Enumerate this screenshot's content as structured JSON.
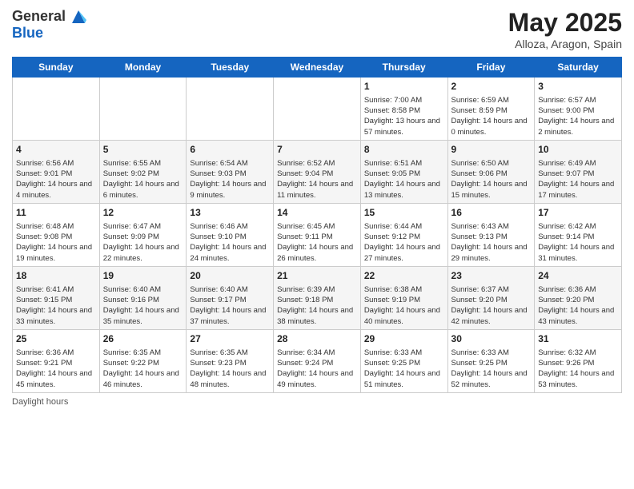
{
  "logo": {
    "line1": "General",
    "line2": "Blue"
  },
  "title": "May 2025",
  "location": "Alloza, Aragon, Spain",
  "days_of_week": [
    "Sunday",
    "Monday",
    "Tuesday",
    "Wednesday",
    "Thursday",
    "Friday",
    "Saturday"
  ],
  "footer": "Daylight hours",
  "weeks": [
    [
      {
        "day": "",
        "sunrise": "",
        "sunset": "",
        "daylight": ""
      },
      {
        "day": "",
        "sunrise": "",
        "sunset": "",
        "daylight": ""
      },
      {
        "day": "",
        "sunrise": "",
        "sunset": "",
        "daylight": ""
      },
      {
        "day": "",
        "sunrise": "",
        "sunset": "",
        "daylight": ""
      },
      {
        "day": "1",
        "sunrise": "Sunrise: 7:00 AM",
        "sunset": "Sunset: 8:58 PM",
        "daylight": "Daylight: 13 hours and 57 minutes."
      },
      {
        "day": "2",
        "sunrise": "Sunrise: 6:59 AM",
        "sunset": "Sunset: 8:59 PM",
        "daylight": "Daylight: 14 hours and 0 minutes."
      },
      {
        "day": "3",
        "sunrise": "Sunrise: 6:57 AM",
        "sunset": "Sunset: 9:00 PM",
        "daylight": "Daylight: 14 hours and 2 minutes."
      }
    ],
    [
      {
        "day": "4",
        "sunrise": "Sunrise: 6:56 AM",
        "sunset": "Sunset: 9:01 PM",
        "daylight": "Daylight: 14 hours and 4 minutes."
      },
      {
        "day": "5",
        "sunrise": "Sunrise: 6:55 AM",
        "sunset": "Sunset: 9:02 PM",
        "daylight": "Daylight: 14 hours and 6 minutes."
      },
      {
        "day": "6",
        "sunrise": "Sunrise: 6:54 AM",
        "sunset": "Sunset: 9:03 PM",
        "daylight": "Daylight: 14 hours and 9 minutes."
      },
      {
        "day": "7",
        "sunrise": "Sunrise: 6:52 AM",
        "sunset": "Sunset: 9:04 PM",
        "daylight": "Daylight: 14 hours and 11 minutes."
      },
      {
        "day": "8",
        "sunrise": "Sunrise: 6:51 AM",
        "sunset": "Sunset: 9:05 PM",
        "daylight": "Daylight: 14 hours and 13 minutes."
      },
      {
        "day": "9",
        "sunrise": "Sunrise: 6:50 AM",
        "sunset": "Sunset: 9:06 PM",
        "daylight": "Daylight: 14 hours and 15 minutes."
      },
      {
        "day": "10",
        "sunrise": "Sunrise: 6:49 AM",
        "sunset": "Sunset: 9:07 PM",
        "daylight": "Daylight: 14 hours and 17 minutes."
      }
    ],
    [
      {
        "day": "11",
        "sunrise": "Sunrise: 6:48 AM",
        "sunset": "Sunset: 9:08 PM",
        "daylight": "Daylight: 14 hours and 19 minutes."
      },
      {
        "day": "12",
        "sunrise": "Sunrise: 6:47 AM",
        "sunset": "Sunset: 9:09 PM",
        "daylight": "Daylight: 14 hours and 22 minutes."
      },
      {
        "day": "13",
        "sunrise": "Sunrise: 6:46 AM",
        "sunset": "Sunset: 9:10 PM",
        "daylight": "Daylight: 14 hours and 24 minutes."
      },
      {
        "day": "14",
        "sunrise": "Sunrise: 6:45 AM",
        "sunset": "Sunset: 9:11 PM",
        "daylight": "Daylight: 14 hours and 26 minutes."
      },
      {
        "day": "15",
        "sunrise": "Sunrise: 6:44 AM",
        "sunset": "Sunset: 9:12 PM",
        "daylight": "Daylight: 14 hours and 27 minutes."
      },
      {
        "day": "16",
        "sunrise": "Sunrise: 6:43 AM",
        "sunset": "Sunset: 9:13 PM",
        "daylight": "Daylight: 14 hours and 29 minutes."
      },
      {
        "day": "17",
        "sunrise": "Sunrise: 6:42 AM",
        "sunset": "Sunset: 9:14 PM",
        "daylight": "Daylight: 14 hours and 31 minutes."
      }
    ],
    [
      {
        "day": "18",
        "sunrise": "Sunrise: 6:41 AM",
        "sunset": "Sunset: 9:15 PM",
        "daylight": "Daylight: 14 hours and 33 minutes."
      },
      {
        "day": "19",
        "sunrise": "Sunrise: 6:40 AM",
        "sunset": "Sunset: 9:16 PM",
        "daylight": "Daylight: 14 hours and 35 minutes."
      },
      {
        "day": "20",
        "sunrise": "Sunrise: 6:40 AM",
        "sunset": "Sunset: 9:17 PM",
        "daylight": "Daylight: 14 hours and 37 minutes."
      },
      {
        "day": "21",
        "sunrise": "Sunrise: 6:39 AM",
        "sunset": "Sunset: 9:18 PM",
        "daylight": "Daylight: 14 hours and 38 minutes."
      },
      {
        "day": "22",
        "sunrise": "Sunrise: 6:38 AM",
        "sunset": "Sunset: 9:19 PM",
        "daylight": "Daylight: 14 hours and 40 minutes."
      },
      {
        "day": "23",
        "sunrise": "Sunrise: 6:37 AM",
        "sunset": "Sunset: 9:20 PM",
        "daylight": "Daylight: 14 hours and 42 minutes."
      },
      {
        "day": "24",
        "sunrise": "Sunrise: 6:36 AM",
        "sunset": "Sunset: 9:20 PM",
        "daylight": "Daylight: 14 hours and 43 minutes."
      }
    ],
    [
      {
        "day": "25",
        "sunrise": "Sunrise: 6:36 AM",
        "sunset": "Sunset: 9:21 PM",
        "daylight": "Daylight: 14 hours and 45 minutes."
      },
      {
        "day": "26",
        "sunrise": "Sunrise: 6:35 AM",
        "sunset": "Sunset: 9:22 PM",
        "daylight": "Daylight: 14 hours and 46 minutes."
      },
      {
        "day": "27",
        "sunrise": "Sunrise: 6:35 AM",
        "sunset": "Sunset: 9:23 PM",
        "daylight": "Daylight: 14 hours and 48 minutes."
      },
      {
        "day": "28",
        "sunrise": "Sunrise: 6:34 AM",
        "sunset": "Sunset: 9:24 PM",
        "daylight": "Daylight: 14 hours and 49 minutes."
      },
      {
        "day": "29",
        "sunrise": "Sunrise: 6:33 AM",
        "sunset": "Sunset: 9:25 PM",
        "daylight": "Daylight: 14 hours and 51 minutes."
      },
      {
        "day": "30",
        "sunrise": "Sunrise: 6:33 AM",
        "sunset": "Sunset: 9:25 PM",
        "daylight": "Daylight: 14 hours and 52 minutes."
      },
      {
        "day": "31",
        "sunrise": "Sunrise: 6:32 AM",
        "sunset": "Sunset: 9:26 PM",
        "daylight": "Daylight: 14 hours and 53 minutes."
      }
    ]
  ]
}
